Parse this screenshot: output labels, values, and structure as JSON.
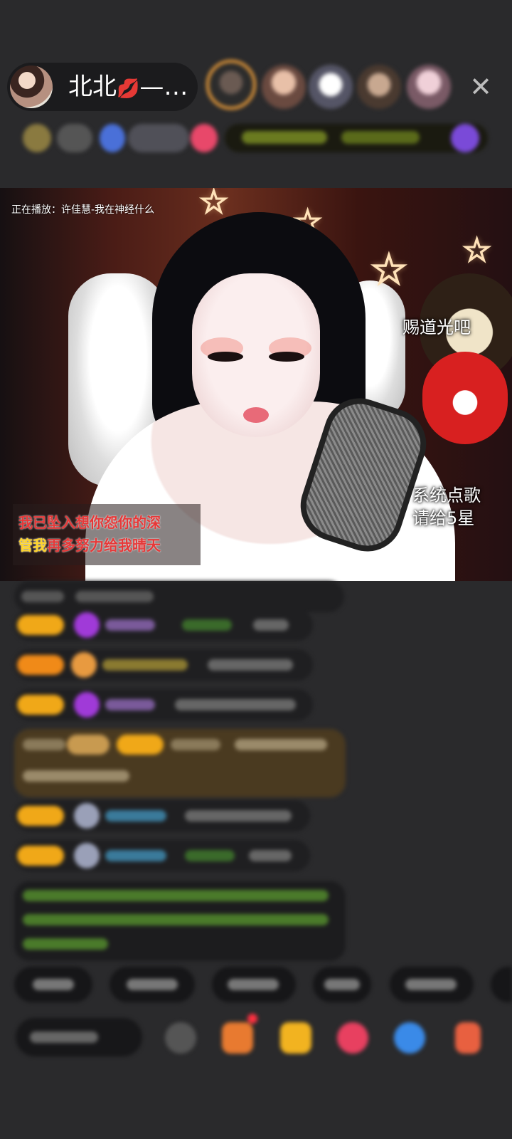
{
  "header": {
    "host_name": "北北",
    "host_name_suffix": "—…",
    "lips_icon": "💋",
    "close_symbol": "✕"
  },
  "video": {
    "now_playing": "正在播放：许佳慧-我在神经什么",
    "overlay_gift_text": "赐道光吧",
    "overlay_song_line1": "系统点歌",
    "overlay_song_line2": "请给5星",
    "lyric_line1": "我已坠入想你怨你的深",
    "lyric_line2_highlight": "管我",
    "lyric_line2_rest": "再多努力给我晴天"
  },
  "colors": {
    "accent_gold": "#f0a818",
    "accent_orange": "#f08a18",
    "chat_bg": "#1f1f21",
    "system_msg_bg": "#4a3a20",
    "green_text": "#7fcf4a"
  },
  "icons": [
    "host-avatar",
    "lips-icon",
    "close-icon",
    "comment-icon",
    "gift-icon",
    "share-icon"
  ]
}
